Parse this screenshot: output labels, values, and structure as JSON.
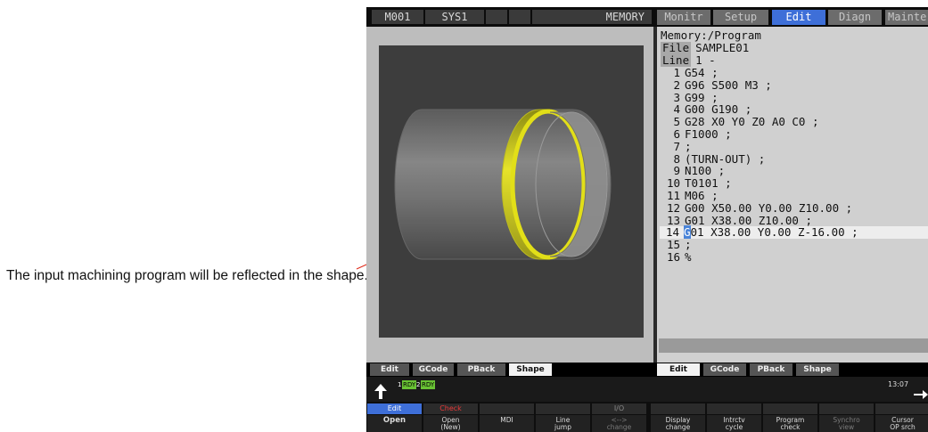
{
  "annotation": "The input machining program will be reflected in the shape.",
  "topbar": {
    "cells": [
      "M001",
      "SYS1",
      "",
      "",
      "MEMORY"
    ],
    "menu_tabs": [
      "Monitr",
      "Setup",
      "Edit",
      "Diagn",
      "Mainte"
    ],
    "active_menu_tab": "Edit"
  },
  "program": {
    "path": "Memory:/Program",
    "file_label": "File",
    "file_name": "SAMPLE01",
    "line_label": "Line",
    "line_value": "1 -",
    "lines": [
      {
        "n": "1",
        "code": "G54 ;"
      },
      {
        "n": "2",
        "code": "G96 S500 M3 ;"
      },
      {
        "n": "3",
        "code": "G99 ;"
      },
      {
        "n": "4",
        "code": "G00 G190 ;"
      },
      {
        "n": "5",
        "code": "G28 X0 Y0 Z0 A0 C0 ;"
      },
      {
        "n": "6",
        "code": "F1000 ;"
      },
      {
        "n": "7",
        "code": ";"
      },
      {
        "n": "8",
        "code": "(TURN-OUT) ;"
      },
      {
        "n": "9",
        "code": "N100 ;"
      },
      {
        "n": "10",
        "code": "T0101 ;"
      },
      {
        "n": "11",
        "code": "M06 ;"
      },
      {
        "n": "12",
        "code": "G00 X50.00 Y0.00 Z10.00 ;"
      },
      {
        "n": "13",
        "code": "G01 X38.00 Z10.00 ;"
      },
      {
        "n": "14",
        "code": "G01 X38.00 Y0.00 Z-16.00 ;"
      },
      {
        "n": "15",
        "code": ";"
      },
      {
        "n": "16",
        "code": "%"
      }
    ],
    "cursor_line": "14"
  },
  "screen_tabs_left": [
    "Edit",
    "GCode",
    "PBack",
    "Shape"
  ],
  "active_left_tab": "Shape",
  "screen_tabs_right": [
    "Edit",
    "GCode",
    "PBack",
    "Shape"
  ],
  "active_right_tab": "Edit",
  "status": {
    "indicators": [
      "1",
      "RDY",
      "2",
      "RDY"
    ],
    "time": "13:07"
  },
  "menu_modes": [
    "Edit",
    "Check",
    "",
    "",
    "I/O",
    "",
    "",
    "",
    "",
    ""
  ],
  "function_keys": [
    "Open",
    "Open\n(New)",
    "MDI",
    "Line\njump",
    "<-->\nchange",
    "Display\nchange",
    "Intrctv\ncycle",
    "Program\ncheck",
    "Synchro\nview",
    "Cursor\nOP srch"
  ],
  "colors": {
    "menu_active": "#3e6fd8",
    "ready_green": "#69c234",
    "shape_highlight": "#e2df18",
    "leader_line": "#e03020",
    "check_red": "#e83a3a"
  }
}
